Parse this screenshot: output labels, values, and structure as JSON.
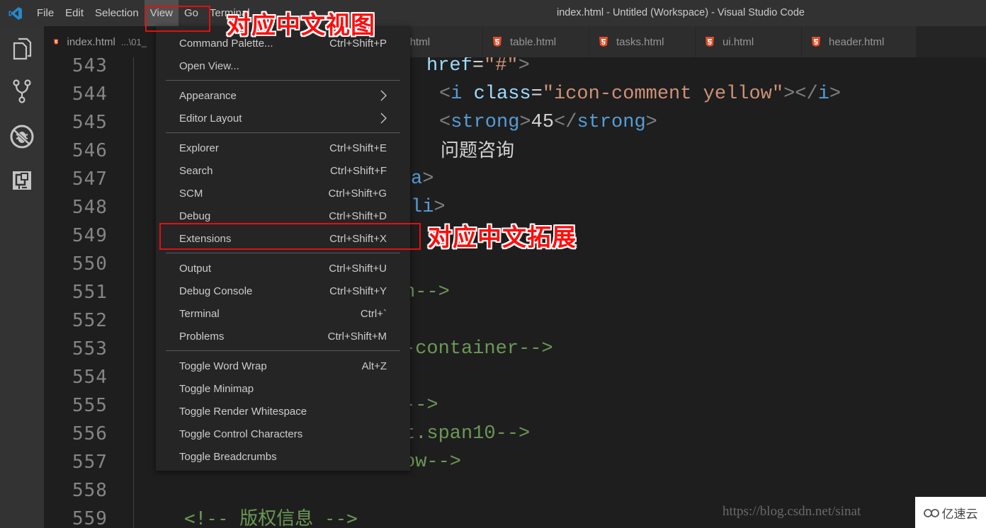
{
  "titlebar": {
    "menus": [
      "File",
      "Edit",
      "Selection",
      "View",
      "Go",
      "Terminal"
    ],
    "active_menu": "View",
    "window_title": "index.html - Untitled (Workspace) - Visual Studio Code"
  },
  "activitybar": {
    "icons": [
      "explorer-icon",
      "source-control-icon",
      "debug-icon",
      "extensions-icon"
    ]
  },
  "tabs": [
    {
      "label": "index.html",
      "desc": "...\\01_",
      "active": true
    },
    {
      "label": "ages.html",
      "active": false
    },
    {
      "label": "table.html",
      "active": false
    },
    {
      "label": "tasks.html",
      "active": false
    },
    {
      "label": "ui.html",
      "active": false
    },
    {
      "label": "header.html",
      "active": false
    }
  ],
  "editor": {
    "line_numbers": [
      "543",
      "544",
      "545",
      "546",
      "547",
      "548",
      "549",
      "550",
      "551",
      "552",
      "553",
      "554",
      "555",
      "556",
      "557",
      "558",
      "559"
    ],
    "lines": {
      "l543": {
        "attr": "href",
        "eq": "=",
        "str": "\"#\"",
        "close": ">"
      },
      "l544": {
        "open": "<",
        "tag": "i",
        "attr": "class",
        "eq": "=",
        "str": "\"icon-comment yellow\"",
        "close": "></",
        "tag2": "i",
        "end": ">"
      },
      "l545": {
        "open": "<",
        "tag": "strong",
        "close": ">",
        "text": "45",
        "open2": "</",
        "tag2": "strong",
        "end": ">"
      },
      "l546": {
        "text": "问题咨询"
      },
      "l547": {
        "tag": "a",
        "end": ">"
      },
      "l548": {
        "tag": "li",
        "end": ">"
      },
      "l551": {
        "cmt": "n-->"
      },
      "l553": {
        "cmt": "-container-->"
      },
      "l555": {
        "cmt": "-->"
      },
      "l556": {
        "cmt": "t.span10-->"
      },
      "l557": {
        "cmt": "ow-->"
      },
      "l559": {
        "cmt": "<!-- 版权信息 -->"
      }
    }
  },
  "view_menu": {
    "groups": [
      [
        {
          "label": "Command Palette...",
          "shortcut": "Ctrl+Shift+P"
        },
        {
          "label": "Open View...",
          "shortcut": ""
        }
      ],
      [
        {
          "label": "Appearance",
          "submenu": true
        },
        {
          "label": "Editor Layout",
          "submenu": true
        }
      ],
      [
        {
          "label": "Explorer",
          "shortcut": "Ctrl+Shift+E"
        },
        {
          "label": "Search",
          "shortcut": "Ctrl+Shift+F"
        },
        {
          "label": "SCM",
          "shortcut": "Ctrl+Shift+G"
        },
        {
          "label": "Debug",
          "shortcut": "Ctrl+Shift+D"
        },
        {
          "label": "Extensions",
          "shortcut": "Ctrl+Shift+X"
        }
      ],
      [
        {
          "label": "Output",
          "shortcut": "Ctrl+Shift+U"
        },
        {
          "label": "Debug Console",
          "shortcut": "Ctrl+Shift+Y"
        },
        {
          "label": "Terminal",
          "shortcut": "Ctrl+`"
        },
        {
          "label": "Problems",
          "shortcut": "Ctrl+Shift+M"
        }
      ],
      [
        {
          "label": "Toggle Word Wrap",
          "shortcut": "Alt+Z"
        },
        {
          "label": "Toggle Minimap",
          "shortcut": ""
        },
        {
          "label": "Toggle Render Whitespace",
          "shortcut": ""
        },
        {
          "label": "Toggle Control Characters",
          "shortcut": ""
        },
        {
          "label": "Toggle Breadcrumbs",
          "shortcut": ""
        }
      ]
    ]
  },
  "annotations": {
    "view_label": "对应中文视图",
    "extensions_label": "对应中文拓展",
    "color": "#ff0d0d"
  },
  "watermark": {
    "url": "https://blog.csdn.net/sinat",
    "badge": "亿速云"
  }
}
